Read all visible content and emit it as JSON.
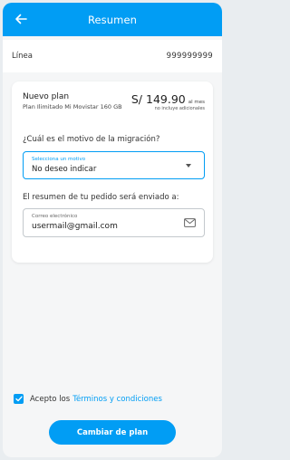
{
  "header": {
    "title": "Resumen",
    "back_icon": "arrow-left-icon"
  },
  "line": {
    "label": "Línea",
    "number": "999999999"
  },
  "plan": {
    "name": "Nuevo plan",
    "description": "Plan Ilimitado Mi Movistar 160 GB",
    "price": "S/ 149.90",
    "price_unit": "al mes",
    "price_note": "no incluye adicionales"
  },
  "migration": {
    "question": "¿Cuál es el motivo de la migración?",
    "select_label": "Selecciona un motivo",
    "select_value": "No deseo indicar",
    "arrow_icon": "caret-down-icon"
  },
  "email": {
    "intro": "El resumen de tu pedido será enviado a:",
    "label": "Correo electrónico",
    "value": "usermail@gmail.com",
    "icon": "envelope-icon"
  },
  "terms": {
    "checked": true,
    "prefix": "Acepto los",
    "link": "Términos y condiciones"
  },
  "cta": {
    "label": "Cambiar de plan"
  },
  "colors": {
    "accent": "#019df4",
    "background": "#f5f6f7"
  }
}
